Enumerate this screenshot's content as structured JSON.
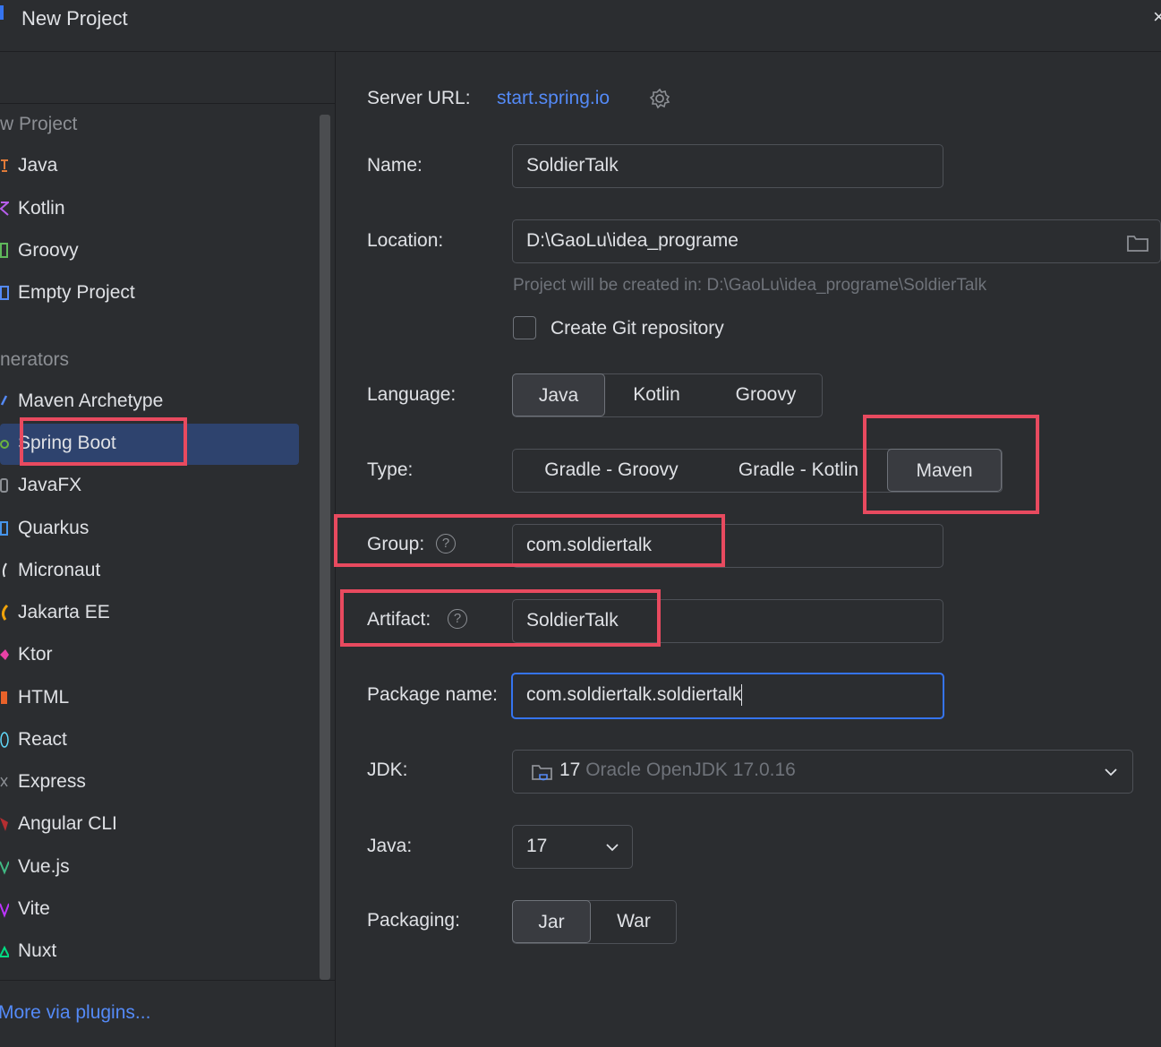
{
  "window": {
    "title": "New Project",
    "close": "×"
  },
  "sidebar": {
    "section_new": "w Project",
    "new_items": [
      {
        "label": "Java",
        "icon": "java-icon",
        "color": "#e07b39"
      },
      {
        "label": "Kotlin",
        "icon": "kotlin-icon",
        "color": "#b75eed"
      },
      {
        "label": "Groovy",
        "icon": "groovy-icon",
        "color": "#5fb85b"
      },
      {
        "label": "Empty Project",
        "icon": "empty-project-icon",
        "color": "#548af7"
      }
    ],
    "section_generators": "nerators",
    "gen_items": [
      {
        "label": "Maven Archetype",
        "icon": "maven-icon",
        "color": "#548af7"
      },
      {
        "label": "Spring Boot",
        "icon": "spring-boot-icon",
        "color": "#6cb33e"
      },
      {
        "label": "JavaFX",
        "icon": "javafx-icon",
        "color": "#8c8f94"
      },
      {
        "label": "Quarkus",
        "icon": "quarkus-icon",
        "color": "#4695eb"
      },
      {
        "label": "Micronaut",
        "icon": "micronaut-icon",
        "color": "#dfe1e5"
      },
      {
        "label": "Jakarta EE",
        "icon": "jakarta-icon",
        "color": "#f0a30a"
      },
      {
        "label": "Ktor",
        "icon": "ktor-icon",
        "color": "#e841a6"
      },
      {
        "label": "HTML",
        "icon": "html-icon",
        "color": "#e8622a"
      },
      {
        "label": "React",
        "icon": "react-icon",
        "color": "#61dafb"
      },
      {
        "label": "Express",
        "icon": "express-icon",
        "color": "#8c8f94"
      },
      {
        "label": "Angular CLI",
        "icon": "angular-icon",
        "color": "#b52e31"
      },
      {
        "label": "Vue.js",
        "icon": "vue-icon",
        "color": "#41b883"
      },
      {
        "label": "Vite",
        "icon": "vite-icon",
        "color": "#bd34fe"
      },
      {
        "label": "Nuxt",
        "icon": "nuxt-icon",
        "color": "#00dc82"
      }
    ],
    "selected": "Spring Boot",
    "more_plugins": "More via plugins..."
  },
  "form": {
    "server_url_label": "Server URL:",
    "server_url": "start.spring.io",
    "name_label": "Name:",
    "name_value": "SoldierTalk",
    "location_label": "Location:",
    "location_value": "D:\\GaoLu\\idea_programe",
    "location_hint": "Project will be created in: D:\\GaoLu\\idea_programe\\SoldierTalk",
    "git_label": "Create Git repository",
    "git_checked": false,
    "language_label": "Language:",
    "languages": [
      "Java",
      "Kotlin",
      "Groovy"
    ],
    "language_selected": "Java",
    "type_label": "Type:",
    "types": [
      "Gradle - Groovy",
      "Gradle - Kotlin",
      "Maven"
    ],
    "type_selected": "Maven",
    "group_label": "Group:",
    "group_value": "com.soldiertalk",
    "artifact_label": "Artifact:",
    "artifact_value": "SoldierTalk",
    "package_label": "Package name:",
    "package_value": "com.soldiertalk.soldiertalk",
    "jdk_label": "JDK:",
    "jdk_version": "17",
    "jdk_desc": "Oracle OpenJDK 17.0.16",
    "java_label": "Java:",
    "java_value": "17",
    "packaging_label": "Packaging:",
    "packagings": [
      "Jar",
      "War"
    ],
    "packaging_selected": "Jar",
    "help_glyph": "?"
  },
  "colors": {
    "accent": "#3574f0",
    "link": "#548af7",
    "selection": "#2e436e",
    "highlight_box": "#e84a5f"
  }
}
